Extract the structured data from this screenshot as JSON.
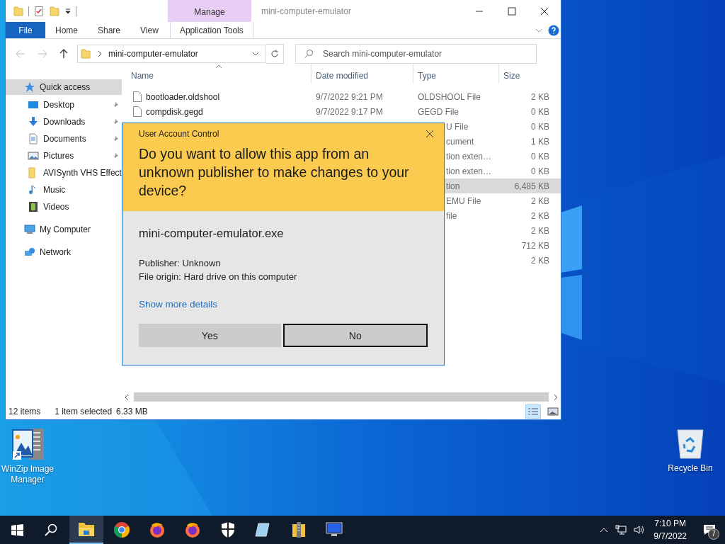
{
  "explorer": {
    "title": "mini-computer-emulator",
    "context_header": "Manage",
    "ribbon_tabs": [
      {
        "label": "File",
        "kind": "file"
      },
      {
        "label": "Home",
        "kind": "plain"
      },
      {
        "label": "Share",
        "kind": "plain"
      },
      {
        "label": "View",
        "kind": "plain"
      },
      {
        "label": "Application Tools",
        "kind": "context"
      }
    ],
    "address": {
      "path": "mini-computer-emulator"
    },
    "search": {
      "placeholder": "Search mini-computer-emulator"
    },
    "nav": [
      {
        "label": "Quick access",
        "kind": "star",
        "selected": true,
        "children": [
          {
            "label": "Desktop",
            "kind": "desktop",
            "pinned": true,
            "selected": false
          },
          {
            "label": "Downloads",
            "kind": "downloads",
            "pinned": true,
            "selected": false
          },
          {
            "label": "Documents",
            "kind": "documents",
            "pinned": true,
            "selected": false
          },
          {
            "label": "Pictures",
            "kind": "pictures",
            "pinned": true,
            "selected": false
          },
          {
            "label": "AVISynth VHS Effect",
            "kind": "folder",
            "pinned": false,
            "selected": false
          },
          {
            "label": "Music",
            "kind": "music",
            "pinned": false,
            "selected": false
          },
          {
            "label": "Videos",
            "kind": "videos",
            "pinned": false,
            "selected": false
          }
        ]
      },
      {
        "label": "My Computer",
        "kind": "computer",
        "selected": false
      },
      {
        "label": "Network",
        "kind": "network",
        "selected": false
      }
    ],
    "columns": [
      {
        "label": "Name",
        "sorted": true
      },
      {
        "label": "Date modified",
        "sorted": false
      },
      {
        "label": "Type",
        "sorted": false
      },
      {
        "label": "Size",
        "sorted": false
      }
    ],
    "rows": [
      {
        "name": "bootloader.oldshool",
        "date": "9/7/2022 9:21 PM",
        "type": "OLDSHOOL File",
        "size": "2 KB",
        "selected": false
      },
      {
        "name": "compdisk.gegd",
        "date": "9/7/2022 9:17 PM",
        "type": "GEGD File",
        "size": "0 KB",
        "selected": false
      },
      {
        "type": "U File",
        "size": "0 KB",
        "selected": false
      },
      {
        "type": "cument",
        "size": "1 KB",
        "selected": false
      },
      {
        "type": "tion exten…",
        "size": "0 KB",
        "selected": false
      },
      {
        "type": "tion exten…",
        "size": "0 KB",
        "selected": false
      },
      {
        "type": "tion",
        "size": "6,485 KB",
        "selected": true
      },
      {
        "type": "EMU File",
        "size": "2 KB",
        "selected": false
      },
      {
        "type": "file",
        "size": "2 KB",
        "selected": false
      },
      {
        "size": "2 KB",
        "selected": false
      },
      {
        "size": "712 KB",
        "selected": false
      },
      {
        "size": "2 KB",
        "selected": false
      }
    ],
    "status": {
      "items": "12 items",
      "selection": "1 item selected",
      "selection_size": "6.33 MB"
    },
    "views": [
      {
        "kind": "details",
        "selected": true
      },
      {
        "kind": "thumbnails",
        "selected": false
      }
    ]
  },
  "dialog": {
    "title": "User Account Control",
    "question": "Do you want to allow this app from an unknown publisher to make changes to your device?",
    "program": "mini-computer-emulator.exe",
    "publisher": "Publisher: Unknown",
    "origin": "File origin: Hard drive on this computer",
    "details_link": "Show more details",
    "buttons": [
      {
        "label": "Yes",
        "focused": false
      },
      {
        "label": "No",
        "focused": true
      }
    ]
  },
  "desktop_icons": [
    {
      "label": "WinZip Image Manager",
      "kind": "winzip"
    },
    {
      "label": "Recycle Bin",
      "kind": "recycle"
    }
  ],
  "taskbar": {
    "apps": [
      {
        "kind": "explorer",
        "active": true
      },
      {
        "kind": "chrome",
        "active": false
      },
      {
        "kind": "firefox",
        "active": false
      },
      {
        "kind": "firefox",
        "active": false
      },
      {
        "kind": "shield",
        "active": false
      },
      {
        "kind": "notepad",
        "active": false
      },
      {
        "kind": "archive",
        "active": false
      },
      {
        "kind": "monitor",
        "active": false
      }
    ],
    "time": "7:10 PM",
    "date": "9/7/2022",
    "notifications": "7"
  }
}
